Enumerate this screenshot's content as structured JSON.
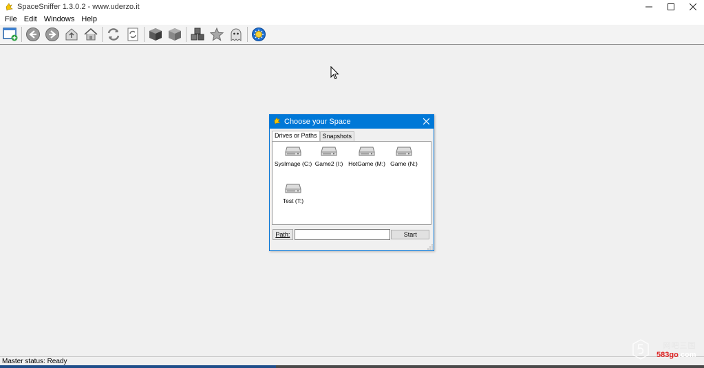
{
  "window": {
    "title": "SpaceSniffer 1.3.0.2 - www.uderzo.it",
    "controls": [
      "minimize-icon",
      "maximize-icon",
      "close-icon"
    ]
  },
  "menu": {
    "items": [
      "File",
      "Edit",
      "Windows",
      "Help"
    ]
  },
  "toolbar": {
    "icons": [
      "new-window-icon",
      "back-icon",
      "forward-icon",
      "up-folder-icon",
      "home-icon",
      "refresh-icon",
      "refresh-doc-icon",
      "cube-icon",
      "cube-outline-icon",
      "cubes-icon",
      "star-icon",
      "ghost-icon",
      "settings-icon"
    ]
  },
  "dialog": {
    "title": "Choose your Space",
    "tabs": [
      {
        "label": "Drives or Paths",
        "active": true
      },
      {
        "label": "Snapshots",
        "active": false
      }
    ],
    "drives": [
      {
        "label": "SysImage (C:)",
        "icon": "drive-icon"
      },
      {
        "label": "Game2 (I:)",
        "icon": "drive-icon"
      },
      {
        "label": "HotGame (M:)",
        "icon": "drive-icon"
      },
      {
        "label": "Game (N:)",
        "icon": "drive-icon"
      },
      {
        "label": "Test (T:)",
        "icon": "drive-icon"
      }
    ],
    "path_label": "Path:",
    "path_value": "",
    "start_label": "Start"
  },
  "status": {
    "text": "Master status: Ready"
  },
  "watermark": {
    "top": "网吧三国",
    "url_prefix": "583go",
    "url_suffix": ".com"
  },
  "colors": {
    "dialog_titlebar": "#0078d7",
    "background": "#f0f0f0"
  }
}
